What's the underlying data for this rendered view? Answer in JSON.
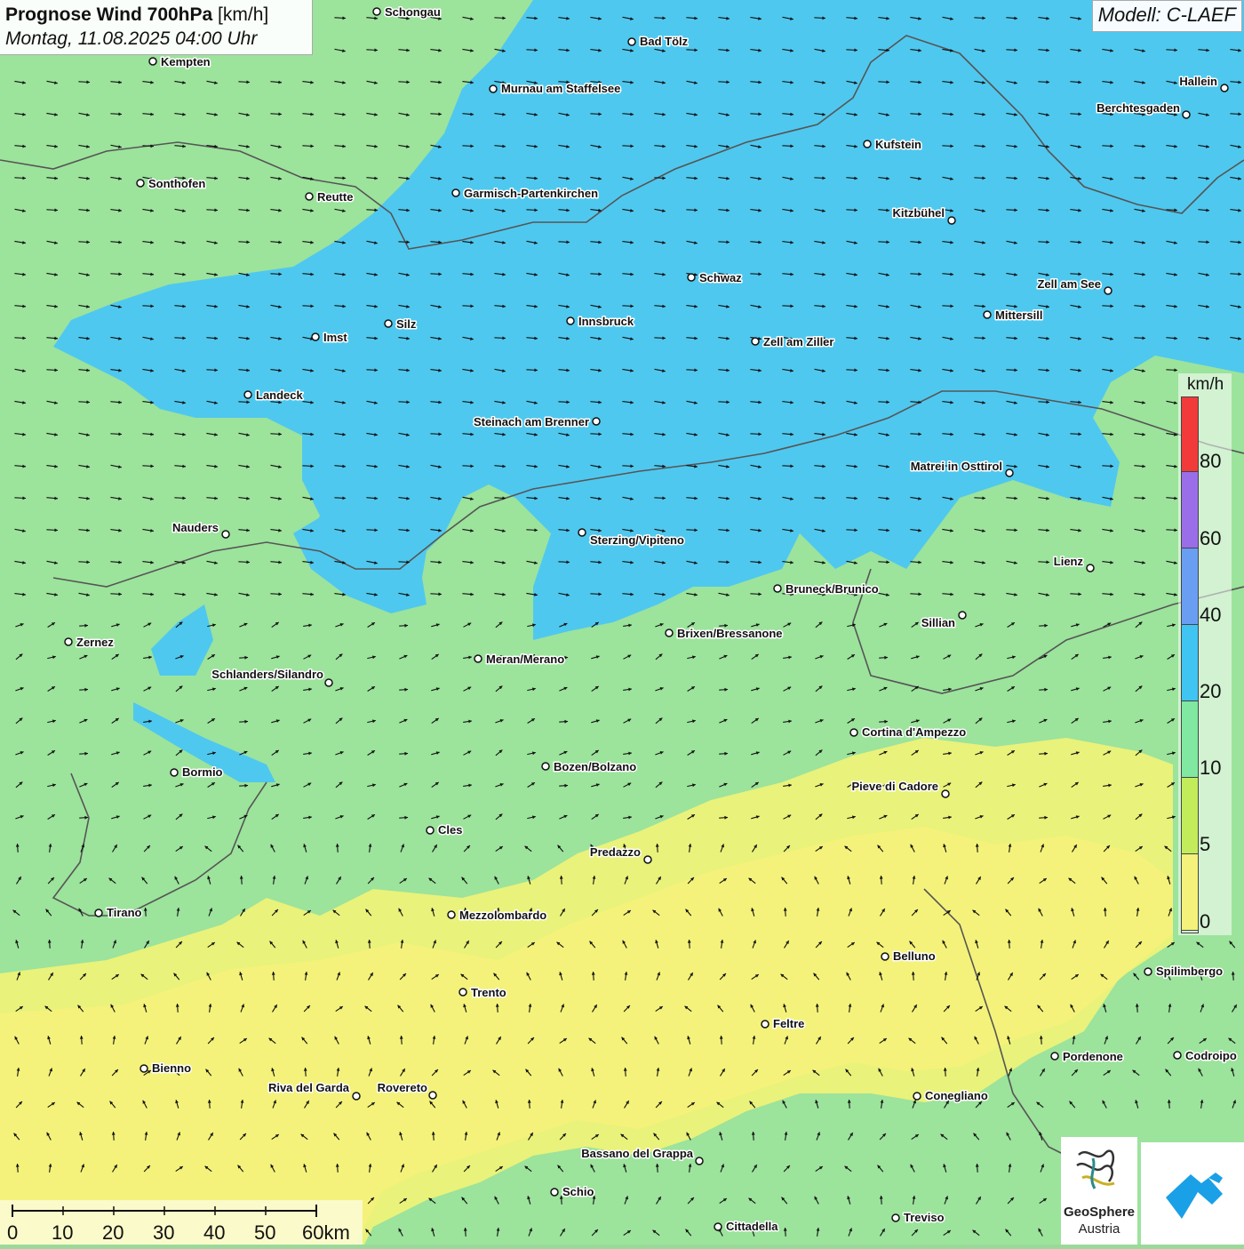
{
  "title": {
    "main": "Prognose Wind 700hPa",
    "unit": "[km/h]",
    "datetime": "Montag, 11.08.2025 04:00 Uhr"
  },
  "model": "Modell: C-LAEF",
  "legend": {
    "unit": "km/h",
    "ticks": [
      "80",
      "60",
      "40",
      "20",
      "10",
      "5",
      "0"
    ],
    "bands": [
      {
        "range": "80+",
        "color": "#f23a3a"
      },
      {
        "range": "60-80",
        "color": "#9a6ee8"
      },
      {
        "range": "40-60",
        "color": "#6a9ef2"
      },
      {
        "range": "20-40",
        "color": "#40c4f2"
      },
      {
        "range": "10-20",
        "color": "#80e8a0"
      },
      {
        "range": "5-10",
        "color": "#c2ec5a"
      },
      {
        "range": "0-5",
        "color": "#f4f27a"
      }
    ]
  },
  "scale_bar": {
    "labels": [
      "0",
      "10",
      "20",
      "30",
      "40",
      "50",
      "60km"
    ]
  },
  "cities": [
    {
      "name": "Schongau"
    },
    {
      "name": "Bad Tölz"
    },
    {
      "name": "Kempten"
    },
    {
      "name": "Murnau am Staffelsee"
    },
    {
      "name": "Hallein"
    },
    {
      "name": "Berchtesgaden"
    },
    {
      "name": "Kufstein"
    },
    {
      "name": "Sonthofen"
    },
    {
      "name": "Reutte"
    },
    {
      "name": "Garmisch-Partenkirchen"
    },
    {
      "name": "Kitzbühel"
    },
    {
      "name": "Schwaz"
    },
    {
      "name": "Zell am See"
    },
    {
      "name": "Mittersill"
    },
    {
      "name": "Innsbruck"
    },
    {
      "name": "Silz"
    },
    {
      "name": "Imst"
    },
    {
      "name": "Zell am Ziller"
    },
    {
      "name": "Landeck"
    },
    {
      "name": "Steinach am Brenner"
    },
    {
      "name": "Matrei in Osttirol"
    },
    {
      "name": "Nauders"
    },
    {
      "name": "Sterzing/Vipiteno"
    },
    {
      "name": "Lienz"
    },
    {
      "name": "Bruneck/Brunico"
    },
    {
      "name": "Sillian"
    },
    {
      "name": "Brixen/Bressanone"
    },
    {
      "name": "Zernez"
    },
    {
      "name": "Meran/Merano"
    },
    {
      "name": "Schlanders/Silandro"
    },
    {
      "name": "Cortina d'Ampezzo"
    },
    {
      "name": "Bozen/Bolzano"
    },
    {
      "name": "Bormio"
    },
    {
      "name": "Pieve di Cadore"
    },
    {
      "name": "Cles"
    },
    {
      "name": "Predazzo"
    },
    {
      "name": "Tirano"
    },
    {
      "name": "Mezzolombardo"
    },
    {
      "name": "Belluno"
    },
    {
      "name": "Spilimbergo"
    },
    {
      "name": "Trento"
    },
    {
      "name": "Feltre"
    },
    {
      "name": "Pordenone"
    },
    {
      "name": "Codroipo"
    },
    {
      "name": "Bienno"
    },
    {
      "name": "Riva del Garda"
    },
    {
      "name": "Rovereto"
    },
    {
      "name": "Conegliano"
    },
    {
      "name": "Bassano del Grappa"
    },
    {
      "name": "Schio"
    },
    {
      "name": "Treviso"
    },
    {
      "name": "Cittadella"
    }
  ],
  "logos": {
    "geosphere_line1": "GeoSphere",
    "geosphere_line2": "Austria"
  },
  "colors": {
    "wind_0_5": "#f4f27a",
    "wind_5_10": "#c2ec5a",
    "wind_10_20": "#9ce39c",
    "wind_20_40": "#4fc8ef",
    "border": "#555555",
    "arrow": "#111111"
  }
}
